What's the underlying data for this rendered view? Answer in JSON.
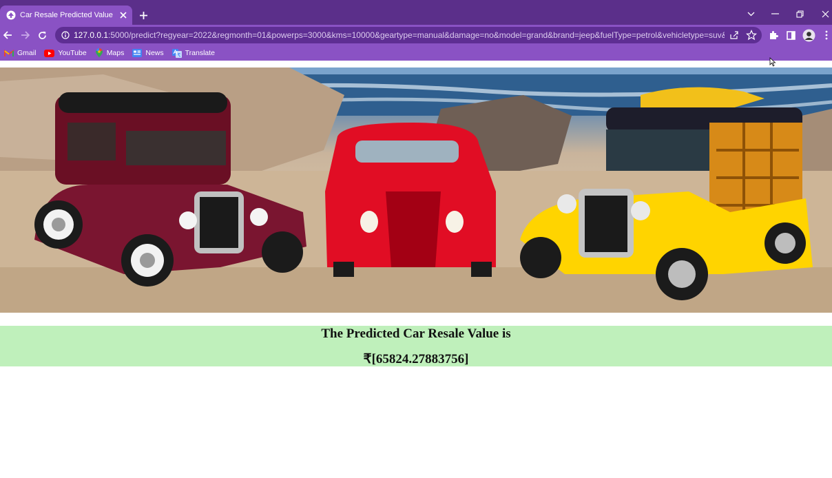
{
  "browser": {
    "tab_title": "Car Resale Predicted Value",
    "url_host": "127.0.0.1",
    "url_rest": ":5000/predict?regyear=2022&regmonth=01&powerps=3000&kms=10000&geartype=manual&damage=no&model=grand&brand=jeep&fuelType=petrol&vehicletype=suv&Submi...",
    "bookmarks": [
      {
        "label": "Gmail",
        "icon": "gmail-icon"
      },
      {
        "label": "YouTube",
        "icon": "youtube-icon"
      },
      {
        "label": "Maps",
        "icon": "maps-icon"
      },
      {
        "label": "News",
        "icon": "news-icon"
      },
      {
        "label": "Translate",
        "icon": "translate-icon"
      }
    ],
    "colors": {
      "frame": "#5b2f8a",
      "toolbar": "#8a52c4"
    }
  },
  "page": {
    "hero_image": "three vintage cars (maroon, red, yellow) parked on a rocky beach",
    "result_heading": "The Predicted Car Resale Value is",
    "result_value": "₹[65824.27883756]",
    "result_background": "#bff0bb"
  }
}
